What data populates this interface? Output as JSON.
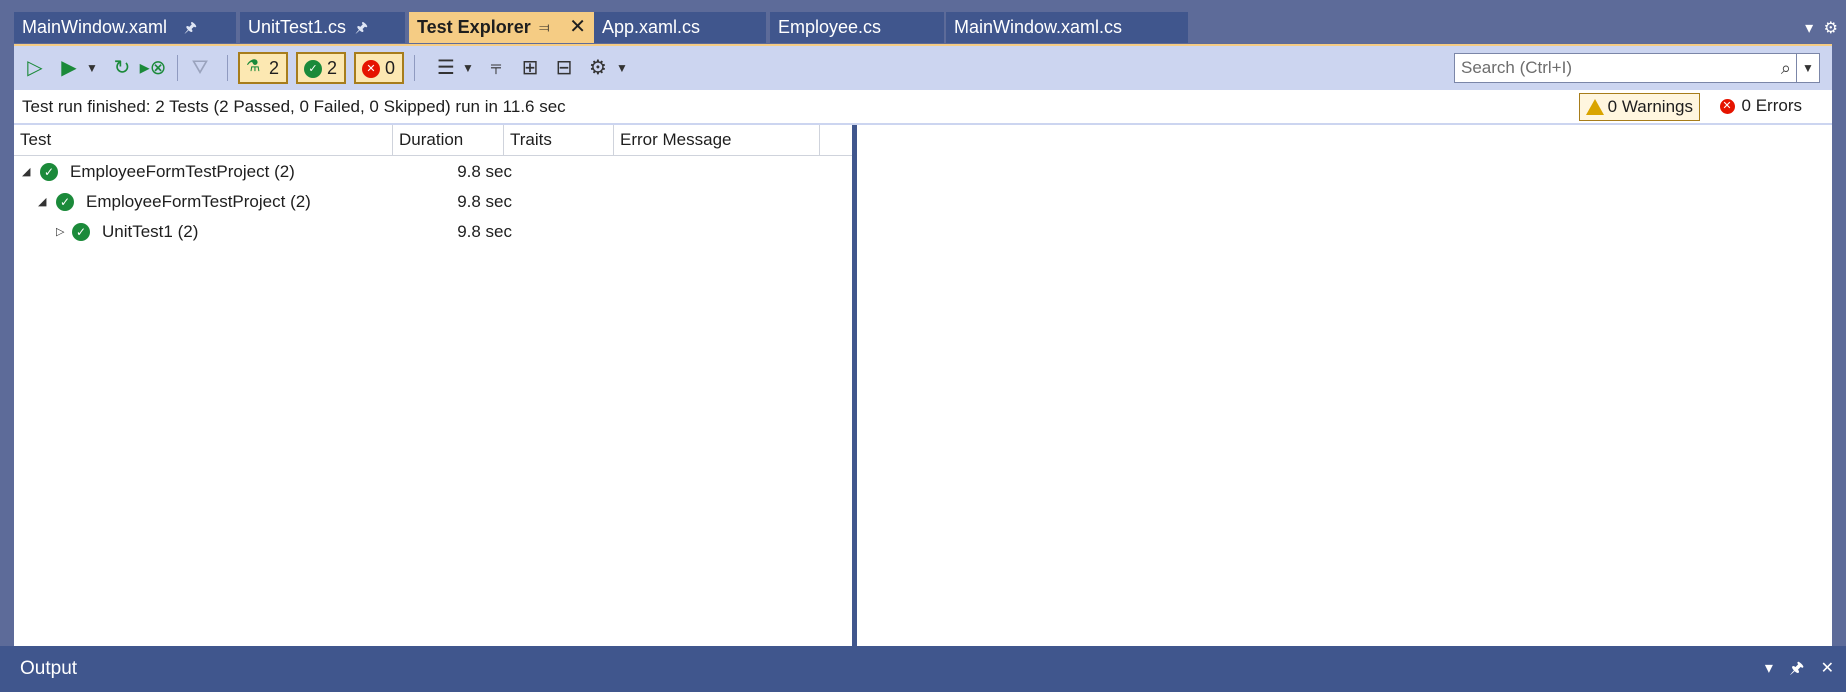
{
  "tabs": [
    {
      "label": "MainWindow.xaml",
      "pinned": true
    },
    {
      "label": "UnitTest1.cs",
      "pinned": true
    },
    {
      "label": "Test Explorer",
      "pinned": true,
      "active": true
    },
    {
      "label": "App.xaml.cs"
    },
    {
      "label": "Employee.cs"
    },
    {
      "label": "MainWindow.xaml.cs"
    }
  ],
  "toolbar": {
    "counters": {
      "total": "2",
      "passed": "2",
      "failed": "0"
    },
    "search_placeholder": "Search (Ctrl+I)"
  },
  "status": {
    "message": "Test run finished: 2 Tests (2 Passed, 0 Failed, 0 Skipped) run in 11.6 sec",
    "warnings": "0 Warnings",
    "errors": "0 Errors"
  },
  "columns": [
    "Test",
    "Duration",
    "Traits",
    "Error Message"
  ],
  "tests": [
    {
      "name": "EmployeeFormTestProject  (2)",
      "duration": "9.8 sec",
      "expanded": true,
      "level": 0
    },
    {
      "name": "EmployeeFormTestProject  (2)",
      "duration": "9.8 sec",
      "expanded": true,
      "level": 1
    },
    {
      "name": "UnitTest1  (2)",
      "duration": "9.8 sec",
      "expanded": false,
      "level": 2
    }
  ],
  "output_title": "Output",
  "colors": {
    "frame": "#5d6b99",
    "tab": "#40568d",
    "active_tab": "#f5cc84",
    "toolbar": "#ccd5f0",
    "passed": "#1b8a3a",
    "failed": "#e51400"
  }
}
